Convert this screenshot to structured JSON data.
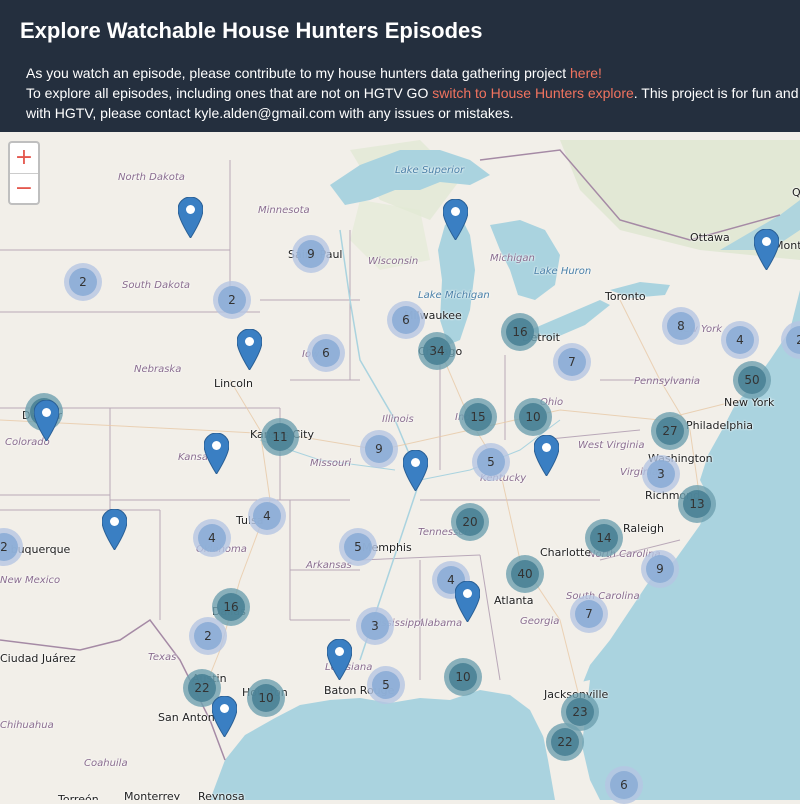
{
  "header": {
    "title": "Explore Watchable House Hunters Episodes",
    "line1_text": "As you watch an episode, please contribute to my house hunters data gathering project ",
    "line1_link": "here!",
    "line2_text_a": "To explore all episodes, including ones that are not on HGTV GO ",
    "line2_link": "switch to House Hunters explore",
    "line2_text_b": ". This project is for fun and",
    "line3_text": "with HGTV, please contact kyle.alden@gmail.com with any issues or mistakes."
  },
  "zoom": {
    "in_label": "+",
    "out_label": "−"
  },
  "colors": {
    "water": "#aad3df",
    "land": "#f2efe9",
    "cluster_small_outer": "rgba(181,198,226,0.8)",
    "cluster_small_inner": "rgba(140,173,214,0.9)",
    "cluster_large_outer": "rgba(110,160,175,0.8)",
    "cluster_large_inner": "rgba(74,130,150,0.9)",
    "pin": "#3a7fc3",
    "header_bg": "#242f3e",
    "link": "#f1735f"
  },
  "places": [
    {
      "name": "Lake Superior",
      "type": "water"
    },
    {
      "name": "North Dakota",
      "type": "state"
    },
    {
      "name": "Minnesota",
      "type": "state"
    },
    {
      "name": "South Dakota",
      "type": "state"
    },
    {
      "name": "Nebraska",
      "type": "state"
    },
    {
      "name": "Iowa",
      "type": "state"
    },
    {
      "name": "Wisconsin",
      "type": "state"
    },
    {
      "name": "Michigan",
      "type": "state"
    },
    {
      "name": "Lake Huron",
      "type": "water"
    },
    {
      "name": "Lake Michigan",
      "type": "water"
    },
    {
      "name": "New York",
      "type": "state"
    },
    {
      "name": "Pennsylvania",
      "type": "state"
    },
    {
      "name": "Ohio",
      "type": "state"
    },
    {
      "name": "Illinois",
      "type": "state"
    },
    {
      "name": "Indiana",
      "type": "state"
    },
    {
      "name": "Colorado",
      "type": "state"
    },
    {
      "name": "Kansas",
      "type": "state"
    },
    {
      "name": "Missouri",
      "type": "state"
    },
    {
      "name": "West Virginia",
      "type": "state"
    },
    {
      "name": "Virginia",
      "type": "state"
    },
    {
      "name": "Kentucky",
      "type": "state"
    },
    {
      "name": "Oklahoma",
      "type": "state"
    },
    {
      "name": "Arkansas",
      "type": "state"
    },
    {
      "name": "Tennessee",
      "type": "state"
    },
    {
      "name": "North Carolina",
      "type": "state"
    },
    {
      "name": "South Carolina",
      "type": "state"
    },
    {
      "name": "Georgia",
      "type": "state"
    },
    {
      "name": "Alabama",
      "type": "state"
    },
    {
      "name": "Mississippi",
      "type": "state"
    },
    {
      "name": "Louisiana",
      "type": "state"
    },
    {
      "name": "Texas",
      "type": "state"
    },
    {
      "name": "New Mexico",
      "type": "state"
    },
    {
      "name": "Chihuahua",
      "type": "state"
    },
    {
      "name": "Coahuila",
      "type": "state"
    },
    {
      "name": "Ottawa",
      "type": "city"
    },
    {
      "name": "Montré",
      "type": "city"
    },
    {
      "name": "Toronto",
      "type": "city"
    },
    {
      "name": "Saint Paul",
      "type": "city"
    },
    {
      "name": "Milwaukee",
      "type": "city"
    },
    {
      "name": "Detroit",
      "type": "city"
    },
    {
      "name": "Chicago",
      "type": "city"
    },
    {
      "name": "Lincoln",
      "type": "city"
    },
    {
      "name": "Denver",
      "type": "city"
    },
    {
      "name": "Kansas City",
      "type": "city"
    },
    {
      "name": "New York",
      "type": "city"
    },
    {
      "name": "Philadelphia",
      "type": "city"
    },
    {
      "name": "Washington",
      "type": "city"
    },
    {
      "name": "Richmond",
      "type": "city"
    },
    {
      "name": "Raleigh",
      "type": "city"
    },
    {
      "name": "Charlotte",
      "type": "city"
    },
    {
      "name": "Memphis",
      "type": "city"
    },
    {
      "name": "Tulsa",
      "type": "city"
    },
    {
      "name": "Atlanta",
      "type": "city"
    },
    {
      "name": "Dallas",
      "type": "city"
    },
    {
      "name": "Austin",
      "type": "city"
    },
    {
      "name": "Houston",
      "type": "city"
    },
    {
      "name": "San Antonio",
      "type": "city"
    },
    {
      "name": "Baton Rouge",
      "type": "city"
    },
    {
      "name": "Jacksonville",
      "type": "city"
    },
    {
      "name": "Ciudad Juárez",
      "type": "city"
    },
    {
      "name": "Albuquerque",
      "type": "city"
    },
    {
      "name": "Monterrey",
      "type": "city"
    },
    {
      "name": "Reynosa",
      "type": "city"
    },
    {
      "name": "Torreón",
      "type": "city"
    },
    {
      "name": "Quebec",
      "type": "city"
    }
  ],
  "clusters": [
    {
      "count": 9
    },
    {
      "count": 2
    },
    {
      "count": 2
    },
    {
      "count": 6
    },
    {
      "count": 6
    },
    {
      "count": 34
    },
    {
      "count": 16
    },
    {
      "count": 8
    },
    {
      "count": 4
    },
    {
      "count": 7
    },
    {
      "count": 50
    },
    {
      "count": 11
    },
    {
      "count": 11
    },
    {
      "count": 15
    },
    {
      "count": 10
    },
    {
      "count": 27
    },
    {
      "count": 9
    },
    {
      "count": 5
    },
    {
      "count": 3
    },
    {
      "count": 13
    },
    {
      "count": 4
    },
    {
      "count": 4
    },
    {
      "count": 20
    },
    {
      "count": 14
    },
    {
      "count": 2
    },
    {
      "count": 5
    },
    {
      "count": 4
    },
    {
      "count": 40
    },
    {
      "count": 9
    },
    {
      "count": 16
    },
    {
      "count": 2
    },
    {
      "count": 3
    },
    {
      "count": 7
    },
    {
      "count": 22
    },
    {
      "count": 10
    },
    {
      "count": 5
    },
    {
      "count": 10
    },
    {
      "count": 23
    },
    {
      "count": 22
    },
    {
      "count": 6
    },
    {
      "count": 2
    }
  ],
  "pins": [
    {
      "name": "pin-north-dakota"
    },
    {
      "name": "pin-michigan"
    },
    {
      "name": "pin-quebec"
    },
    {
      "name": "pin-nebraska"
    },
    {
      "name": "pin-colorado"
    },
    {
      "name": "pin-kansas"
    },
    {
      "name": "pin-missouri"
    },
    {
      "name": "pin-kentucky"
    },
    {
      "name": "pin-new-mexico"
    },
    {
      "name": "pin-alabama"
    },
    {
      "name": "pin-louisiana"
    },
    {
      "name": "pin-texas"
    }
  ]
}
